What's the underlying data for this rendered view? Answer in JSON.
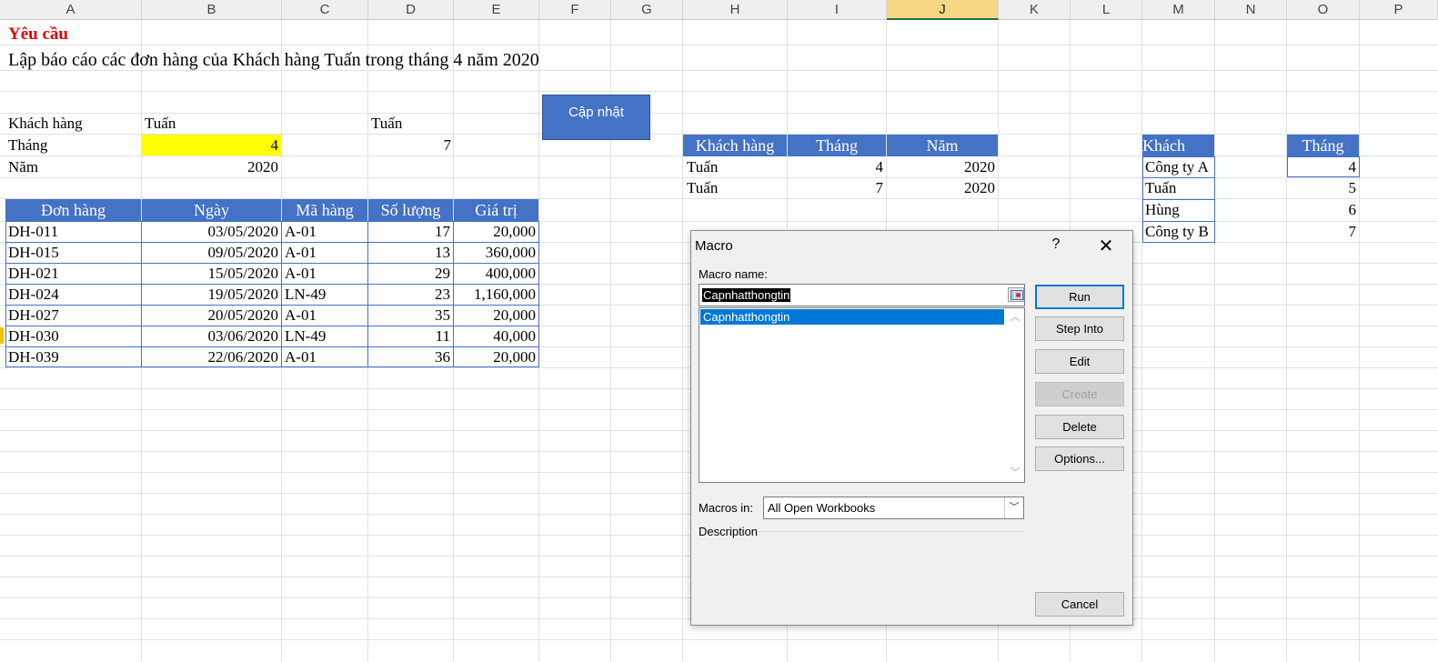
{
  "columns": [
    "A",
    "B",
    "C",
    "D",
    "E",
    "F",
    "G",
    "H",
    "I",
    "J",
    "K",
    "L",
    "M",
    "N",
    "O",
    "P"
  ],
  "requirement": {
    "label": "Yêu cầu",
    "text": "Lập báo cáo các đơn hàng của Khách hàng Tuấn trong tháng 4 năm 2020"
  },
  "criteria": {
    "customer_label": "Khách hàng",
    "customer_value": "Tuấn",
    "customer_value_d": "Tuấn",
    "month_label": "Tháng",
    "month_value": "4",
    "month_value_d": "7",
    "year_label": "Năm",
    "year_value": "2020"
  },
  "update_button": "Cập nhật",
  "orders": {
    "headers": [
      "Đơn hàng",
      "Ngày",
      "Mã hàng",
      "Số lượng",
      "Giá trị"
    ],
    "rows": [
      [
        "DH-011",
        "03/05/2020",
        "A-01",
        "17",
        "20,000"
      ],
      [
        "DH-015",
        "09/05/2020",
        "A-01",
        "13",
        "360,000"
      ],
      [
        "DH-021",
        "15/05/2020",
        "A-01",
        "29",
        "400,000"
      ],
      [
        "DH-024",
        "19/05/2020",
        "LN-49",
        "23",
        "1,160,000"
      ],
      [
        "DH-027",
        "20/05/2020",
        "A-01",
        "35",
        "20,000"
      ],
      [
        "DH-030",
        "03/06/2020",
        "LN-49",
        "11",
        "40,000"
      ],
      [
        "DH-039",
        "22/06/2020",
        "A-01",
        "36",
        "20,000"
      ]
    ]
  },
  "criteria_table": {
    "headers": [
      "Khách hàng",
      "Tháng",
      "Năm"
    ],
    "rows": [
      [
        "Tuấn",
        "4",
        "2020"
      ],
      [
        "Tuấn",
        "7",
        "2020"
      ]
    ]
  },
  "customer_list": {
    "header": "Khách hàng",
    "items": [
      "Công ty A",
      "Tuấn",
      "Hùng",
      "Công ty B"
    ]
  },
  "month_list": {
    "header": "Tháng",
    "items": [
      "4",
      "5",
      "6",
      "7"
    ]
  },
  "dialog": {
    "title": "Macro",
    "help": "?",
    "close": "✕",
    "macro_name_label": "Macro name:",
    "macro_name_value": "Capnhatthongtin",
    "list": [
      "Capnhatthongtin"
    ],
    "buttons": {
      "run": "Run",
      "step_into": "Step Into",
      "edit": "Edit",
      "create": "Create",
      "delete": "Delete",
      "options": "Options...",
      "cancel": "Cancel"
    },
    "macros_in_label": "Macros in:",
    "macros_in_value": "All Open Workbooks",
    "description_label": "Description"
  }
}
